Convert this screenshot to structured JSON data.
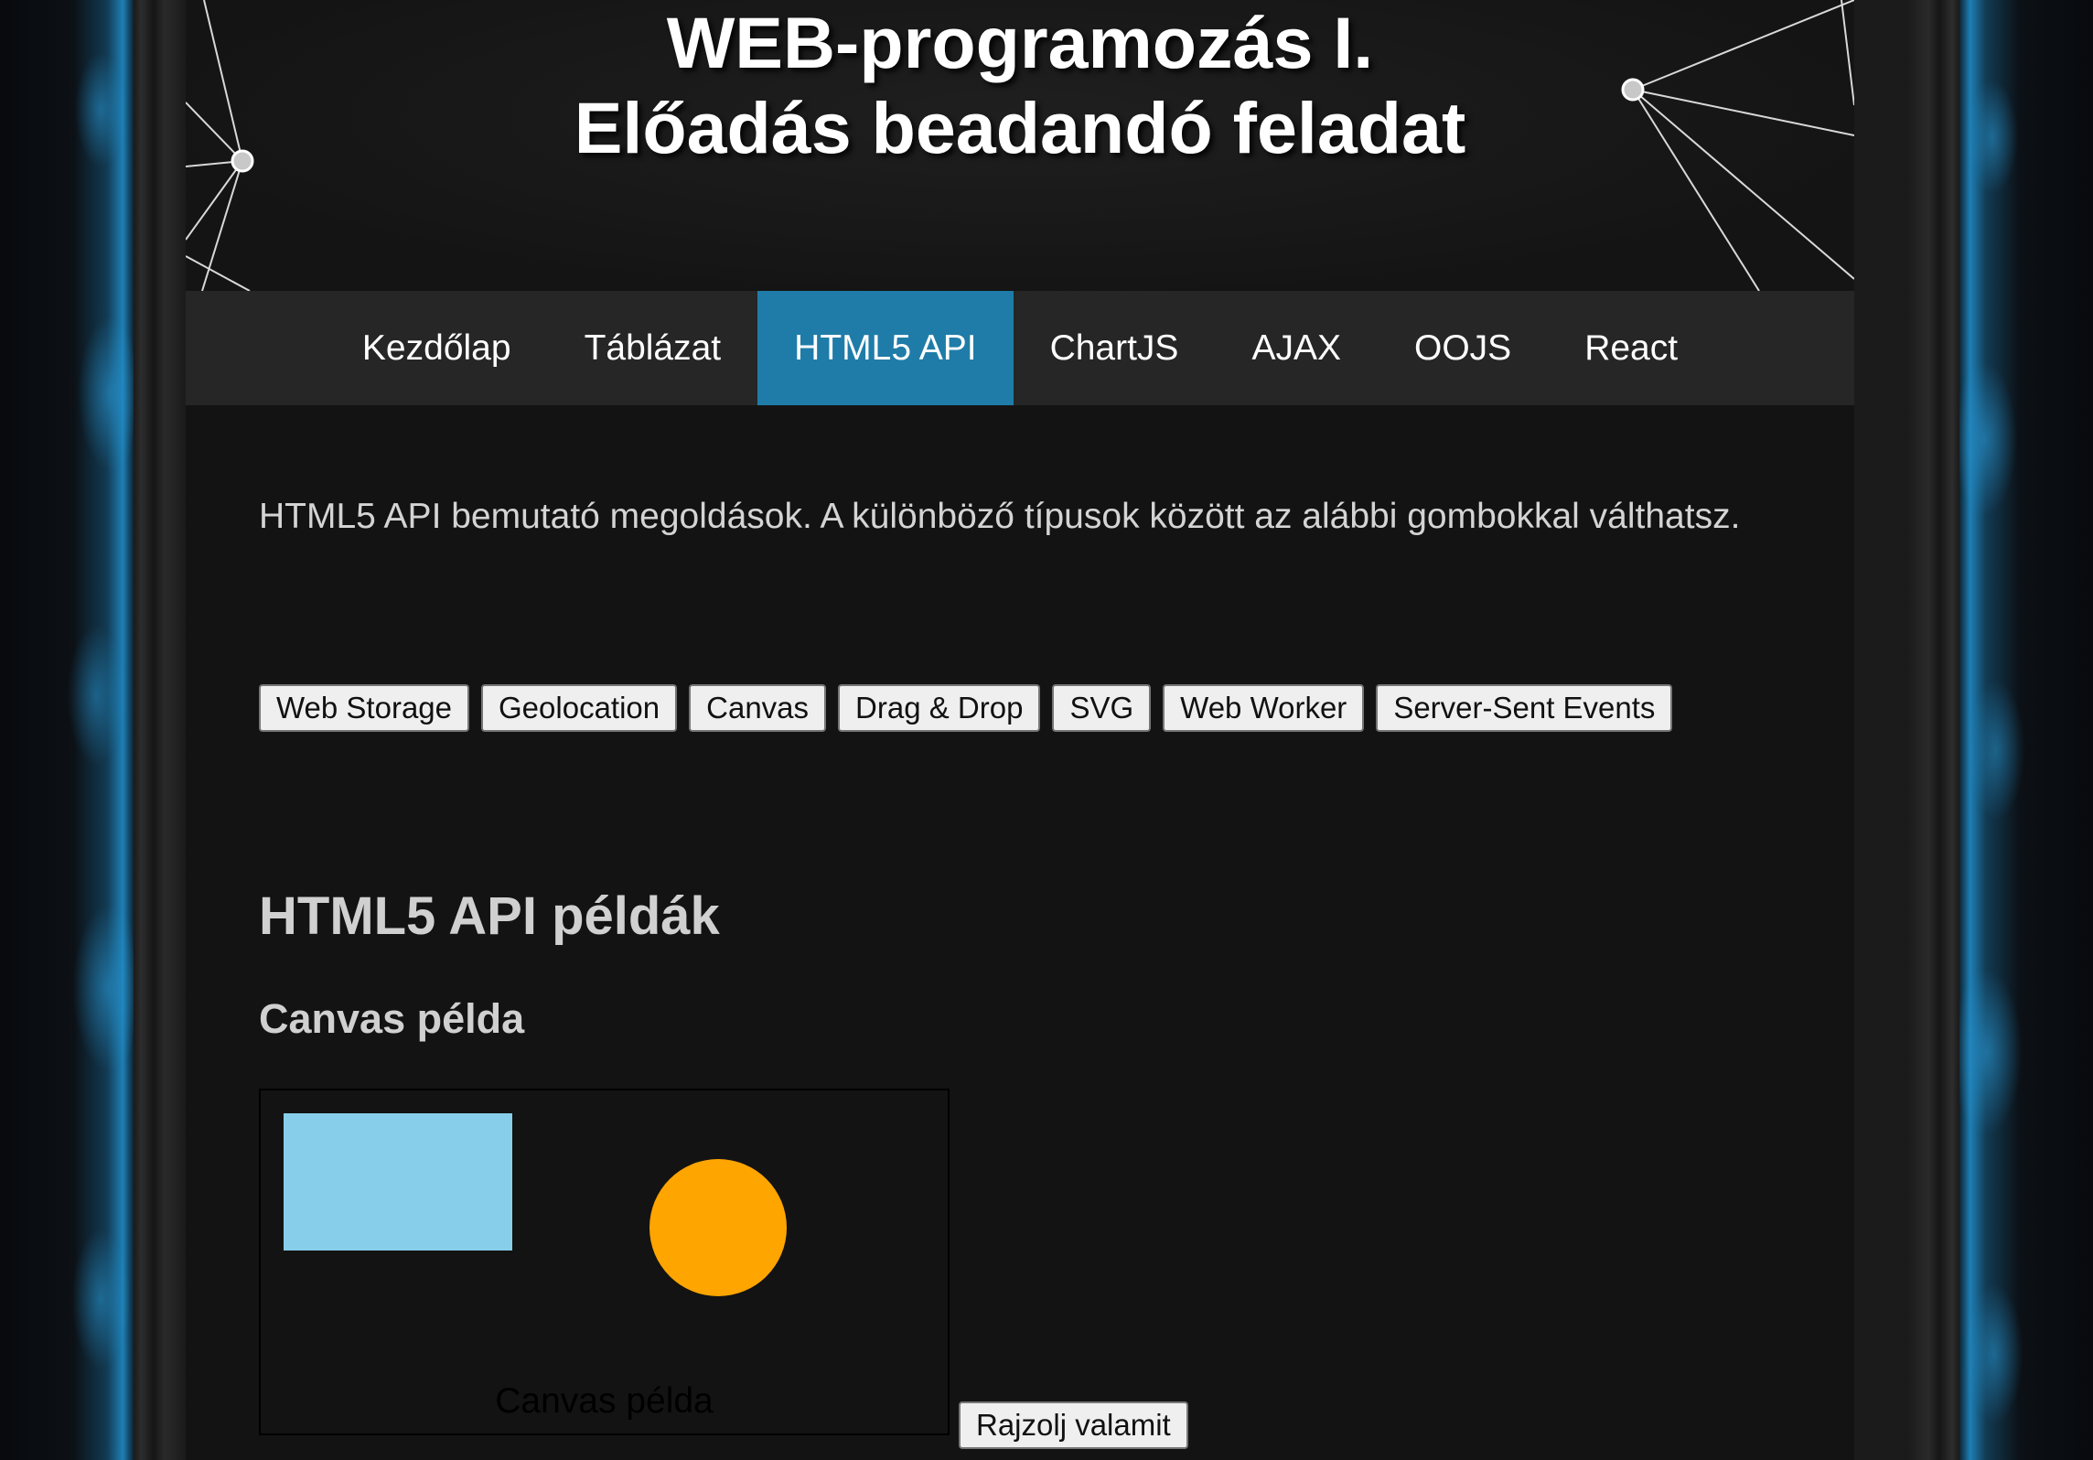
{
  "header": {
    "title_line1": "WEB-programozás I.",
    "title_line2": "Előadás beadandó feladat"
  },
  "nav": {
    "items": [
      {
        "label": "Kezdőlap",
        "active": false
      },
      {
        "label": "Táblázat",
        "active": false
      },
      {
        "label": "HTML5 API",
        "active": true
      },
      {
        "label": "ChartJS",
        "active": false
      },
      {
        "label": "AJAX",
        "active": false
      },
      {
        "label": "OOJS",
        "active": false
      },
      {
        "label": "React",
        "active": false
      }
    ]
  },
  "main": {
    "intro": "HTML5 API bemutató megoldások. A különböző típusok között az alábbi gombokkal válthatsz.",
    "api_buttons": [
      "Web Storage",
      "Geolocation",
      "Canvas",
      "Drag & Drop",
      "SVG",
      "Web Worker",
      "Server-Sent Events"
    ],
    "section_heading": "HTML5 API példák",
    "subsection_heading": "Canvas példa",
    "canvas": {
      "caption": "Canvas példa",
      "rect_color": "#87ceeb",
      "circle_color": "#ffa500"
    },
    "draw_button": "Rajzolj valamit"
  },
  "colors": {
    "active_nav": "#1f7ca8",
    "nav_bg": "#262626",
    "page_bg": "#131313",
    "accent_side": "#1e7fb5"
  }
}
